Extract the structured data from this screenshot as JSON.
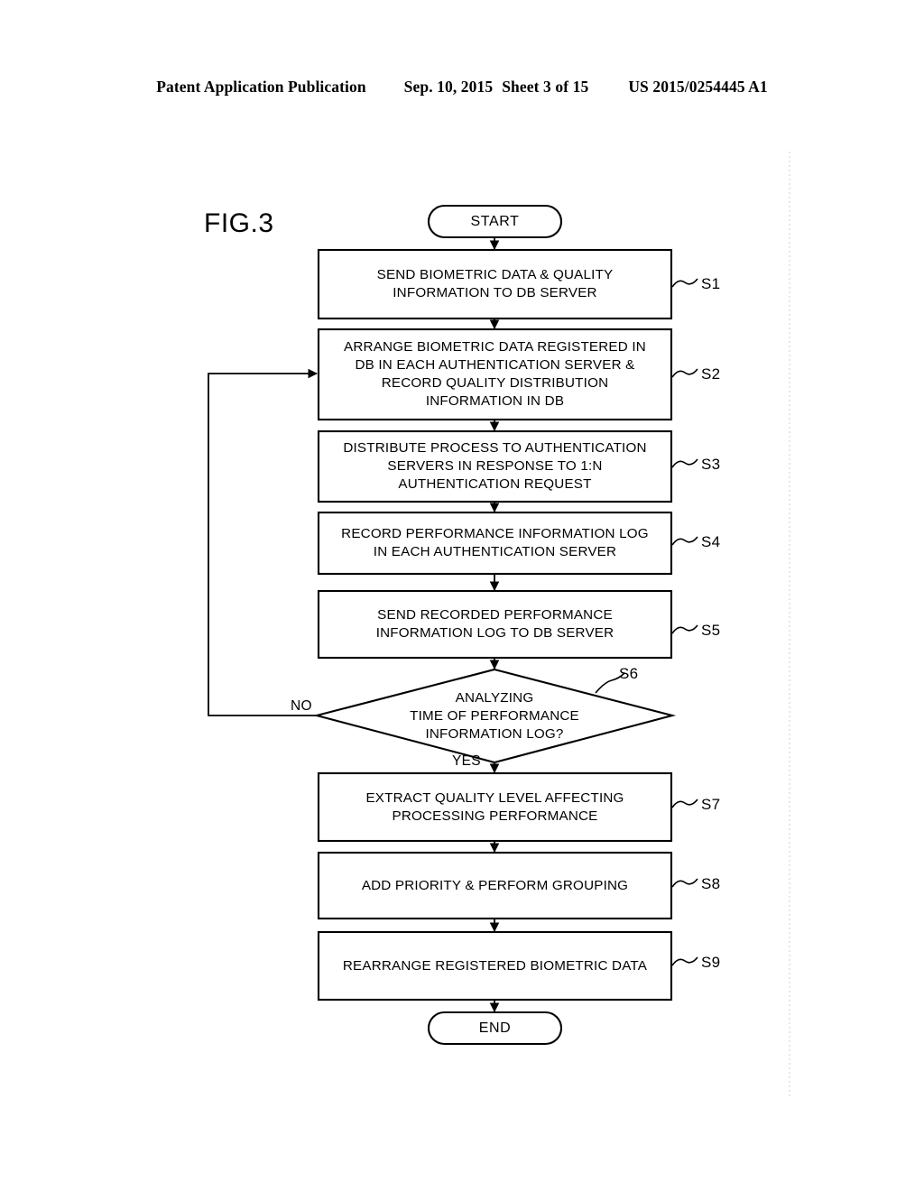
{
  "header": {
    "publication": "Patent Application Publication",
    "date": "Sep. 10, 2015",
    "sheet": "Sheet 3 of 15",
    "number": "US 2015/0254445 A1"
  },
  "figure": {
    "label": "FIG.3"
  },
  "chart_data": {
    "type": "diagram",
    "diagram_kind": "flowchart",
    "title": "FIG.3",
    "orientation": "top-to-bottom",
    "nodes": [
      {
        "id": "start",
        "shape": "terminator",
        "text": "START",
        "step": ""
      },
      {
        "id": "s1",
        "shape": "process",
        "text": "SEND BIOMETRIC DATA & QUALITY\nINFORMATION TO DB SERVER",
        "step": "S1"
      },
      {
        "id": "s2",
        "shape": "process",
        "text": "ARRANGE BIOMETRIC DATA REGISTERED IN\nDB IN EACH AUTHENTICATION SERVER &\nRECORD QUALITY DISTRIBUTION\nINFORMATION IN DB",
        "step": "S2"
      },
      {
        "id": "s3",
        "shape": "process",
        "text": "DISTRIBUTE PROCESS TO AUTHENTICATION\nSERVERS IN RESPONSE TO 1:N\nAUTHENTICATION REQUEST",
        "step": "S3"
      },
      {
        "id": "s4",
        "shape": "process",
        "text": "RECORD PERFORMANCE INFORMATION LOG\nIN EACH AUTHENTICATION SERVER",
        "step": "S4"
      },
      {
        "id": "s5",
        "shape": "process",
        "text": "SEND RECORDED PERFORMANCE\nINFORMATION LOG TO DB SERVER",
        "step": "S5"
      },
      {
        "id": "s6",
        "shape": "decision",
        "text": "ANALYZING\nTIME OF PERFORMANCE\nINFORMATION LOG?",
        "step": "S6"
      },
      {
        "id": "s7",
        "shape": "process",
        "text": "EXTRACT QUALITY LEVEL AFFECTING\nPROCESSING PERFORMANCE",
        "step": "S7"
      },
      {
        "id": "s8",
        "shape": "process",
        "text": "ADD PRIORITY & PERFORM GROUPING",
        "step": "S8"
      },
      {
        "id": "s9",
        "shape": "process",
        "text": "REARRANGE REGISTERED BIOMETRIC DATA",
        "step": "S9"
      },
      {
        "id": "end",
        "shape": "terminator",
        "text": "END",
        "step": ""
      }
    ],
    "edges": [
      {
        "from": "start",
        "to": "s1",
        "label": ""
      },
      {
        "from": "s1",
        "to": "s2",
        "label": ""
      },
      {
        "from": "s2",
        "to": "s3",
        "label": ""
      },
      {
        "from": "s3",
        "to": "s4",
        "label": ""
      },
      {
        "from": "s4",
        "to": "s5",
        "label": ""
      },
      {
        "from": "s5",
        "to": "s6",
        "label": ""
      },
      {
        "from": "s6",
        "to": "s7",
        "label": "YES"
      },
      {
        "from": "s6",
        "to": "s2",
        "label": "NO"
      },
      {
        "from": "s7",
        "to": "s8",
        "label": ""
      },
      {
        "from": "s8",
        "to": "s9",
        "label": ""
      },
      {
        "from": "s9",
        "to": "end",
        "label": ""
      }
    ],
    "branch_labels": {
      "yes": "YES",
      "no": "NO"
    },
    "line_color": "#000000",
    "background": "#ffffff"
  }
}
